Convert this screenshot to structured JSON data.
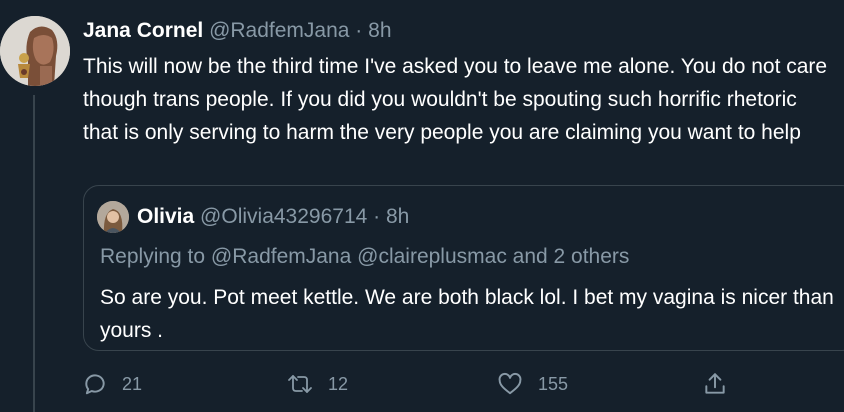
{
  "tweet": {
    "author_name": "Jana Cornel",
    "author_handle": "@RadfemJana",
    "separator": "·",
    "time": "8h",
    "text": "This will now be the third time I've asked you to leave me alone. You do not care though trans people. If you did you wouldn't be spouting such horrific rhetoric that is only serving to harm the very people you are claiming you want to help"
  },
  "quoted": {
    "author_name": "Olivia",
    "author_handle": "@Olivia43296714",
    "separator": "·",
    "time": "8h",
    "replying_prefix": "Replying to",
    "replying_to": "@RadfemJana @claireplusmac and 2 others",
    "text": "So are you. Pot meet kettle.  We are both black lol.  I bet my vagina is nicer than yours ."
  },
  "actions": {
    "reply_count": "21",
    "retweet_count": "12",
    "like_count": "155"
  },
  "icons": {
    "reply": "reply-icon",
    "retweet": "retweet-icon",
    "like": "heart-icon",
    "share": "share-icon"
  },
  "colors": {
    "background": "#15202b",
    "text": "#ffffff",
    "muted": "#8899a6",
    "border": "#38444d"
  }
}
